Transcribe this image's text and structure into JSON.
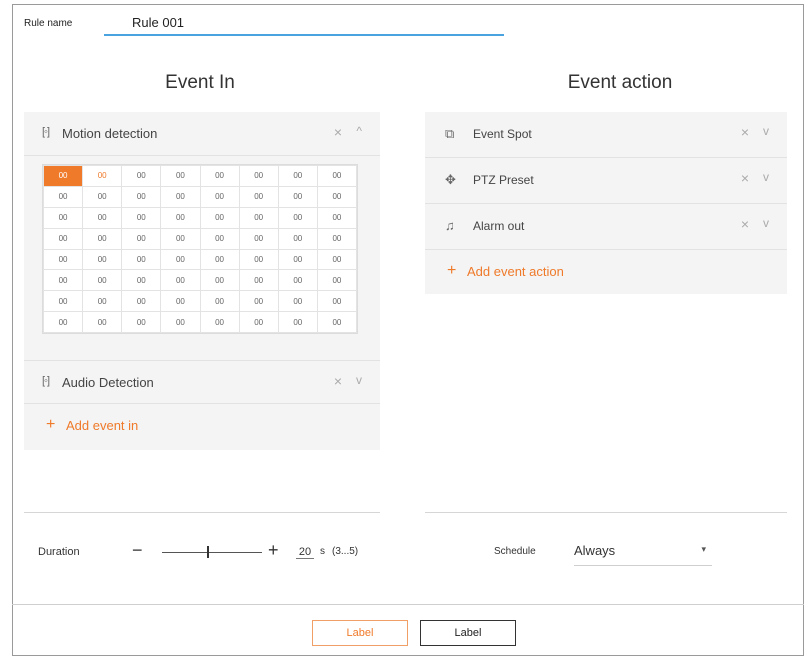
{
  "rule": {
    "label": "Rule name",
    "value": "Rule 001"
  },
  "event_in": {
    "title": "Event In",
    "motion": {
      "label": "Motion detection",
      "icon": "motion-detection-icon",
      "close": "×",
      "toggle": "^",
      "grid": [
        [
          "00",
          "00",
          "00",
          "00",
          "00",
          "00",
          "00",
          "00"
        ],
        [
          "00",
          "00",
          "00",
          "00",
          "00",
          "00",
          "00",
          "00"
        ],
        [
          "00",
          "00",
          "00",
          "00",
          "00",
          "00",
          "00",
          "00"
        ],
        [
          "00",
          "00",
          "00",
          "00",
          "00",
          "00",
          "00",
          "00"
        ],
        [
          "00",
          "00",
          "00",
          "00",
          "00",
          "00",
          "00",
          "00"
        ],
        [
          "00",
          "00",
          "00",
          "00",
          "00",
          "00",
          "00",
          "00"
        ],
        [
          "00",
          "00",
          "00",
          "00",
          "00",
          "00",
          "00",
          "00"
        ],
        [
          "00",
          "00",
          "00",
          "00",
          "00",
          "00",
          "00",
          "00"
        ]
      ]
    },
    "audio": {
      "label": "Audio Detection",
      "icon": "audio-detection-icon",
      "close": "×",
      "toggle": "v"
    },
    "add": {
      "plus": "+",
      "label": "Add event in"
    }
  },
  "event_action": {
    "title": "Event action",
    "items": [
      {
        "label": "Event Spot",
        "icon": "event-spot-icon",
        "close": "×",
        "toggle": "v"
      },
      {
        "label": "PTZ Preset",
        "icon": "ptz-preset-icon",
        "close": "×",
        "toggle": "v"
      },
      {
        "label": "Alarm out",
        "icon": "alarm-out-icon",
        "close": "×",
        "toggle": "v"
      }
    ],
    "add": {
      "plus": "+",
      "label": "Add event action"
    }
  },
  "duration": {
    "label": "Duration",
    "minus": "−",
    "plus": "+",
    "value": "20",
    "unit": "s",
    "range": "(3...5)",
    "slider_fraction": 0.45
  },
  "schedule": {
    "label": "Schedule",
    "value": "Always",
    "arrow": "▾"
  },
  "buttons": {
    "primary": "Label",
    "secondary": "Label"
  },
  "colors": {
    "accent": "#ef7a2a",
    "input_underline": "#4aa3df"
  }
}
